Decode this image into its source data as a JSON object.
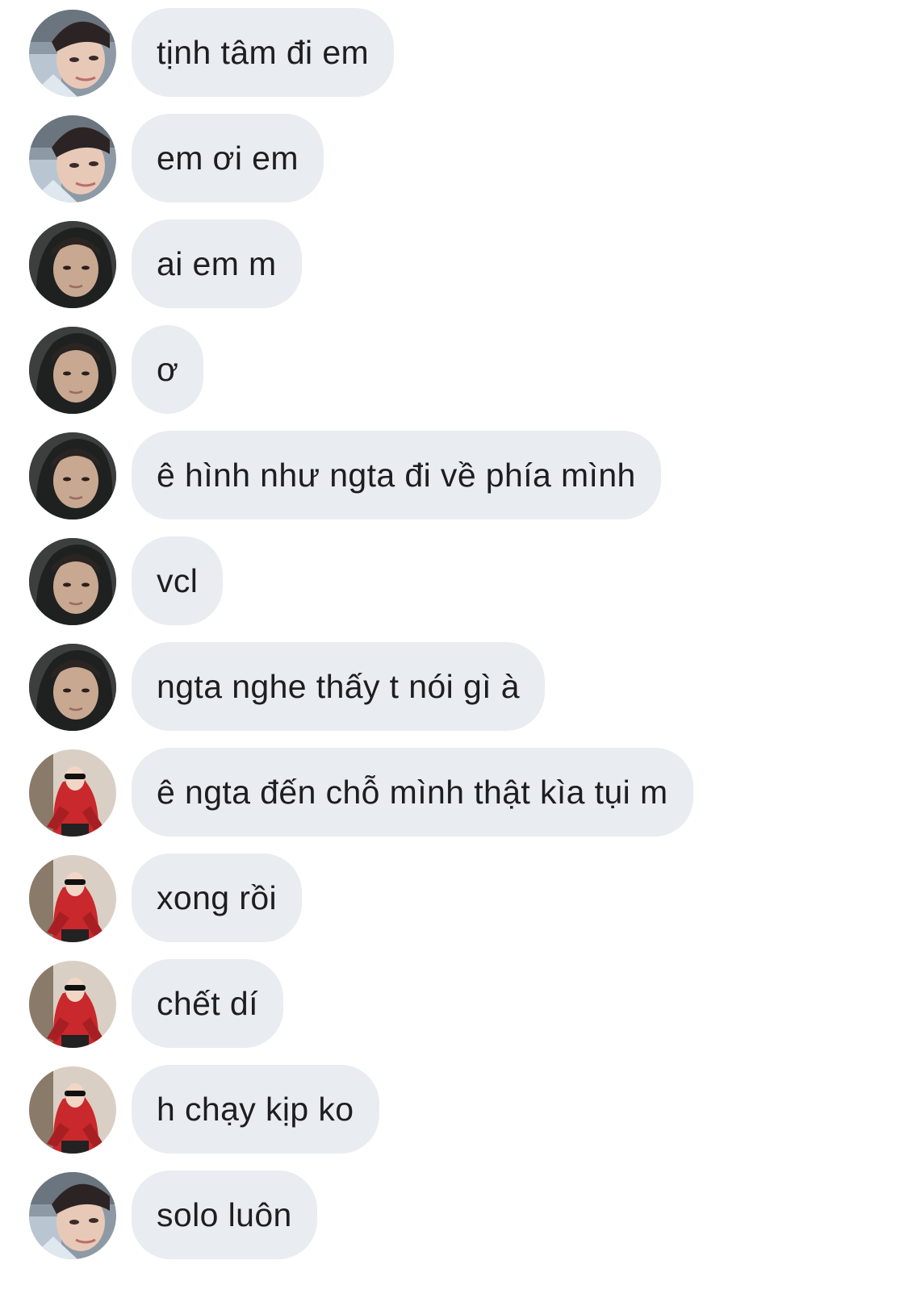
{
  "participants": {
    "a": {
      "avatar_icon": "person-photo-icon-boy-glasses-cap"
    },
    "b": {
      "avatar_icon": "person-photo-icon-boy-dark-hood"
    },
    "c": {
      "avatar_icon": "person-photo-icon-red-hoodie-sunglasses"
    }
  },
  "colors": {
    "bubble_bg": "#e9ecf0",
    "text": "#1c1e21",
    "page_bg": "#ffffff"
  },
  "messages": [
    {
      "sender": "a",
      "text": "tịnh tâm đi em"
    },
    {
      "sender": "a",
      "text": "em ơi em"
    },
    {
      "sender": "b",
      "text": "ai em m"
    },
    {
      "sender": "b",
      "text": "ơ"
    },
    {
      "sender": "b",
      "text": "ê hình như ngta đi về phía mình"
    },
    {
      "sender": "b",
      "text": "vcl"
    },
    {
      "sender": "b",
      "text": "ngta nghe thấy t nói gì à"
    },
    {
      "sender": "c",
      "text": "ê ngta đến chỗ mình thật kìa tụi m"
    },
    {
      "sender": "c",
      "text": "xong rồi"
    },
    {
      "sender": "c",
      "text": "chết dí"
    },
    {
      "sender": "c",
      "text": "h chạy kịp ko"
    },
    {
      "sender": "a",
      "text": "solo luôn"
    }
  ]
}
